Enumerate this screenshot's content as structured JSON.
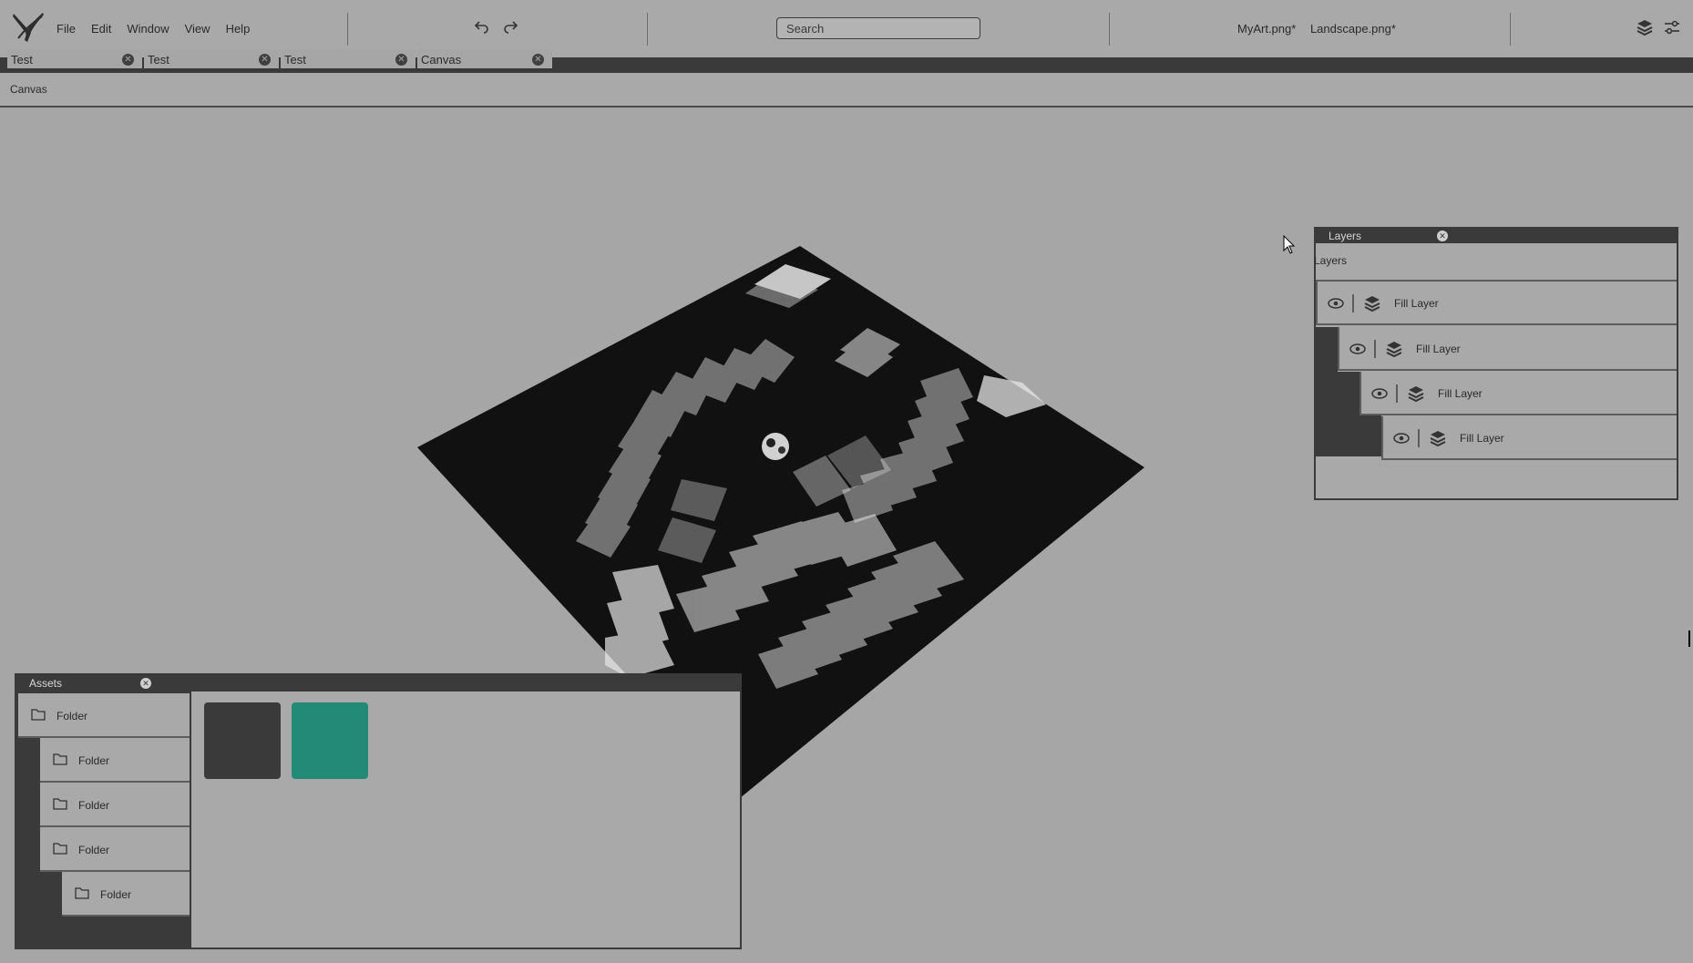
{
  "app": {
    "menu": [
      "File",
      "Edit",
      "Window",
      "View",
      "Help"
    ],
    "search_placeholder": "Search",
    "open_files": [
      "MyArt.png*",
      "Landscape.png*"
    ],
    "colors": {
      "dark": "#3a3a3a",
      "bg": "#a6a6a6",
      "teal": "#238a77",
      "swatch_dark": "#3a3a3a"
    }
  },
  "tabs": [
    {
      "label": "Test"
    },
    {
      "label": "Test"
    },
    {
      "label": "Test"
    },
    {
      "label": "Canvas"
    }
  ],
  "breadcrumb": "Canvas",
  "layers_panel": {
    "tab_title": "Layers",
    "header": "Layers",
    "items": [
      {
        "label": "Fill Layer",
        "visible": true
      },
      {
        "label": "Fill Layer",
        "visible": true
      },
      {
        "label": "Fill Layer",
        "visible": true
      },
      {
        "label": "Fill Layer",
        "visible": true
      }
    ]
  },
  "assets_panel": {
    "tab_title": "Assets",
    "folders": [
      {
        "label": "Folder"
      },
      {
        "label": "Folder"
      },
      {
        "label": "Folder"
      },
      {
        "label": "Folder"
      },
      {
        "label": "Folder"
      }
    ],
    "swatches": [
      {
        "color": "#3a3a3a"
      },
      {
        "color": "#238a77"
      }
    ]
  }
}
